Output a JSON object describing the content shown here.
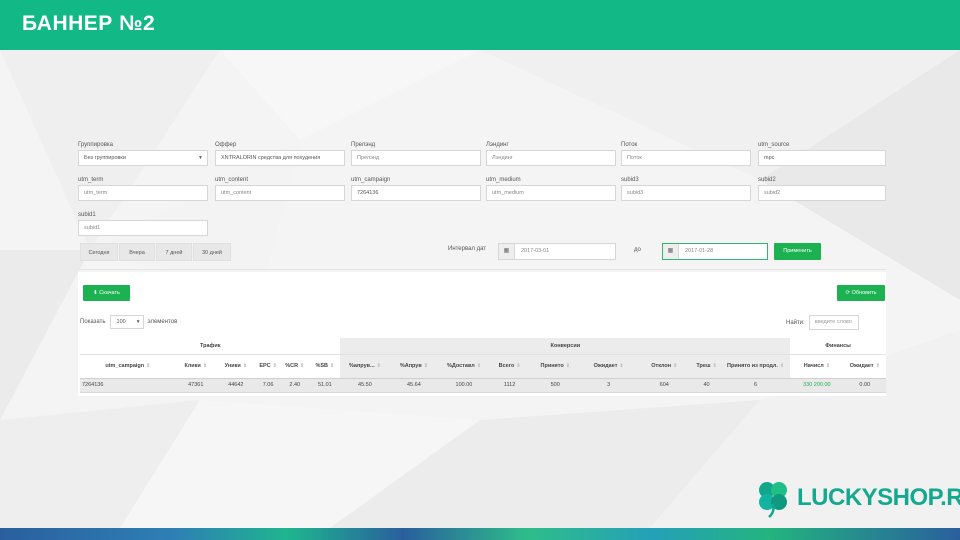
{
  "slide": {
    "title": "БАННЕР №2",
    "logo_text": "LUCKYSHOP.RU"
  },
  "filters": {
    "grouping": {
      "label": "Группировка",
      "value": "Без группировки"
    },
    "offer": {
      "label": "Оффер",
      "value": "XNTRALORIN средства для похудения"
    },
    "traffic_source": {
      "label": "Прелэнд",
      "placeholder": "Прелэнд"
    },
    "landing": {
      "label": "Лэндинг",
      "placeholder": "Лэндинг"
    },
    "stream": {
      "label": "Поток",
      "placeholder": "Поток"
    },
    "utm_source": {
      "label": "utm_source",
      "value": "mpc"
    },
    "utm_term": {
      "label": "utm_term",
      "placeholder": "utm_term"
    },
    "utm_content": {
      "label": "utm_content",
      "placeholder": "utm_content"
    },
    "utm_campaign": {
      "label": "utm_campaign",
      "value": "7264136"
    },
    "utm_medium": {
      "label": "utm_medium",
      "placeholder": "utm_medium"
    },
    "subid3": {
      "label": "subid3",
      "placeholder": "subid3"
    },
    "subid2": {
      "label": "subid2",
      "placeholder": "subid2"
    },
    "subid1": {
      "label": "subid1",
      "placeholder": "subid1"
    }
  },
  "quick_dates": [
    "Сегодня",
    "Вчера",
    "7 дней",
    "30 дней"
  ],
  "interval": {
    "label": "Интервал дат",
    "from": "2017-03-01",
    "to_label": "до",
    "to": "2017-01-28",
    "apply_label": "Применить",
    "calendar_icon": "calendar-icon"
  },
  "toolbar": {
    "download_label": "Скачать",
    "refresh_label": "Обновить",
    "show_label": "Показать",
    "page_size": "100",
    "entries_label": "элементов",
    "search_label": "Найти:",
    "search_placeholder": "введите слово"
  },
  "table": {
    "groups": {
      "traffic": "Трафик",
      "conversions": "Конверсии",
      "finance": "Финансы"
    },
    "columns": [
      "utm_campaign",
      "Клики",
      "Уники",
      "EPC",
      "%CR",
      "%SB",
      "%апрув...",
      "%Апрув",
      "%Доставл",
      "Всего",
      "Принято",
      "Ожидает",
      "Отклон",
      "Треш",
      "Принято из продл.",
      "Начисл",
      "Ожидает"
    ],
    "rows": [
      [
        "7264136",
        "47361",
        "44642",
        "7.06",
        "2.40",
        "51.01",
        "45.50",
        "45.64",
        "100.00",
        "1112",
        "500",
        "3",
        "604",
        "40",
        "6",
        "330 200.00",
        "0.00"
      ]
    ]
  },
  "colors": {
    "brand_green": "#12b886",
    "button_green": "#1cb252",
    "logo_teal": "#14a98f"
  }
}
